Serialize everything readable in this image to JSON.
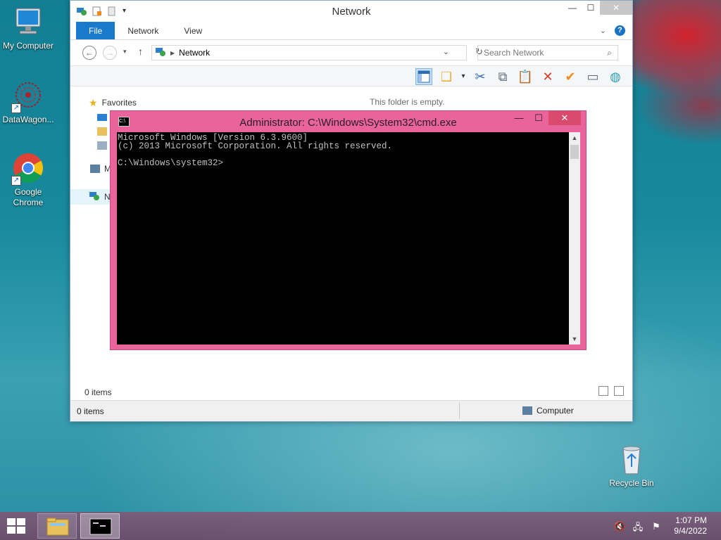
{
  "desktop": {
    "icons": [
      {
        "label": "My Computer",
        "icon": "monitor-icon"
      },
      {
        "label": "DataWagon...",
        "icon": "datawagon-icon"
      },
      {
        "label": "Google\nChrome",
        "icon": "chrome-icon"
      },
      {
        "label": "Recycle Bin",
        "icon": "recycle-bin-icon"
      }
    ]
  },
  "explorer": {
    "title": "Network",
    "tabs": [
      {
        "label": "File"
      },
      {
        "label": "Network"
      },
      {
        "label": "View"
      }
    ],
    "address": "Network",
    "search_placeholder": "Search Network",
    "nav": {
      "favorites": "Favorites",
      "partial_m": "M",
      "partial_n": "N"
    },
    "empty_message": "This folder is empty.",
    "items_count_top": "0 items",
    "status": {
      "items": "0 items",
      "location": "Computer"
    }
  },
  "cmd": {
    "title": "Administrator: C:\\Windows\\System32\\cmd.exe",
    "lines": [
      "Microsoft Windows [Version 6.3.9600]",
      "(c) 2013 Microsoft Corporation. All rights reserved.",
      "",
      "C:\\Windows\\system32>"
    ]
  },
  "taskbar": {
    "time": "1:07 PM",
    "date": "9/4/2022"
  },
  "colors": {
    "cmd_frame": "#e8649a",
    "ribbon_file_tab": "#1979ca",
    "taskbar": "#7d5a78"
  }
}
